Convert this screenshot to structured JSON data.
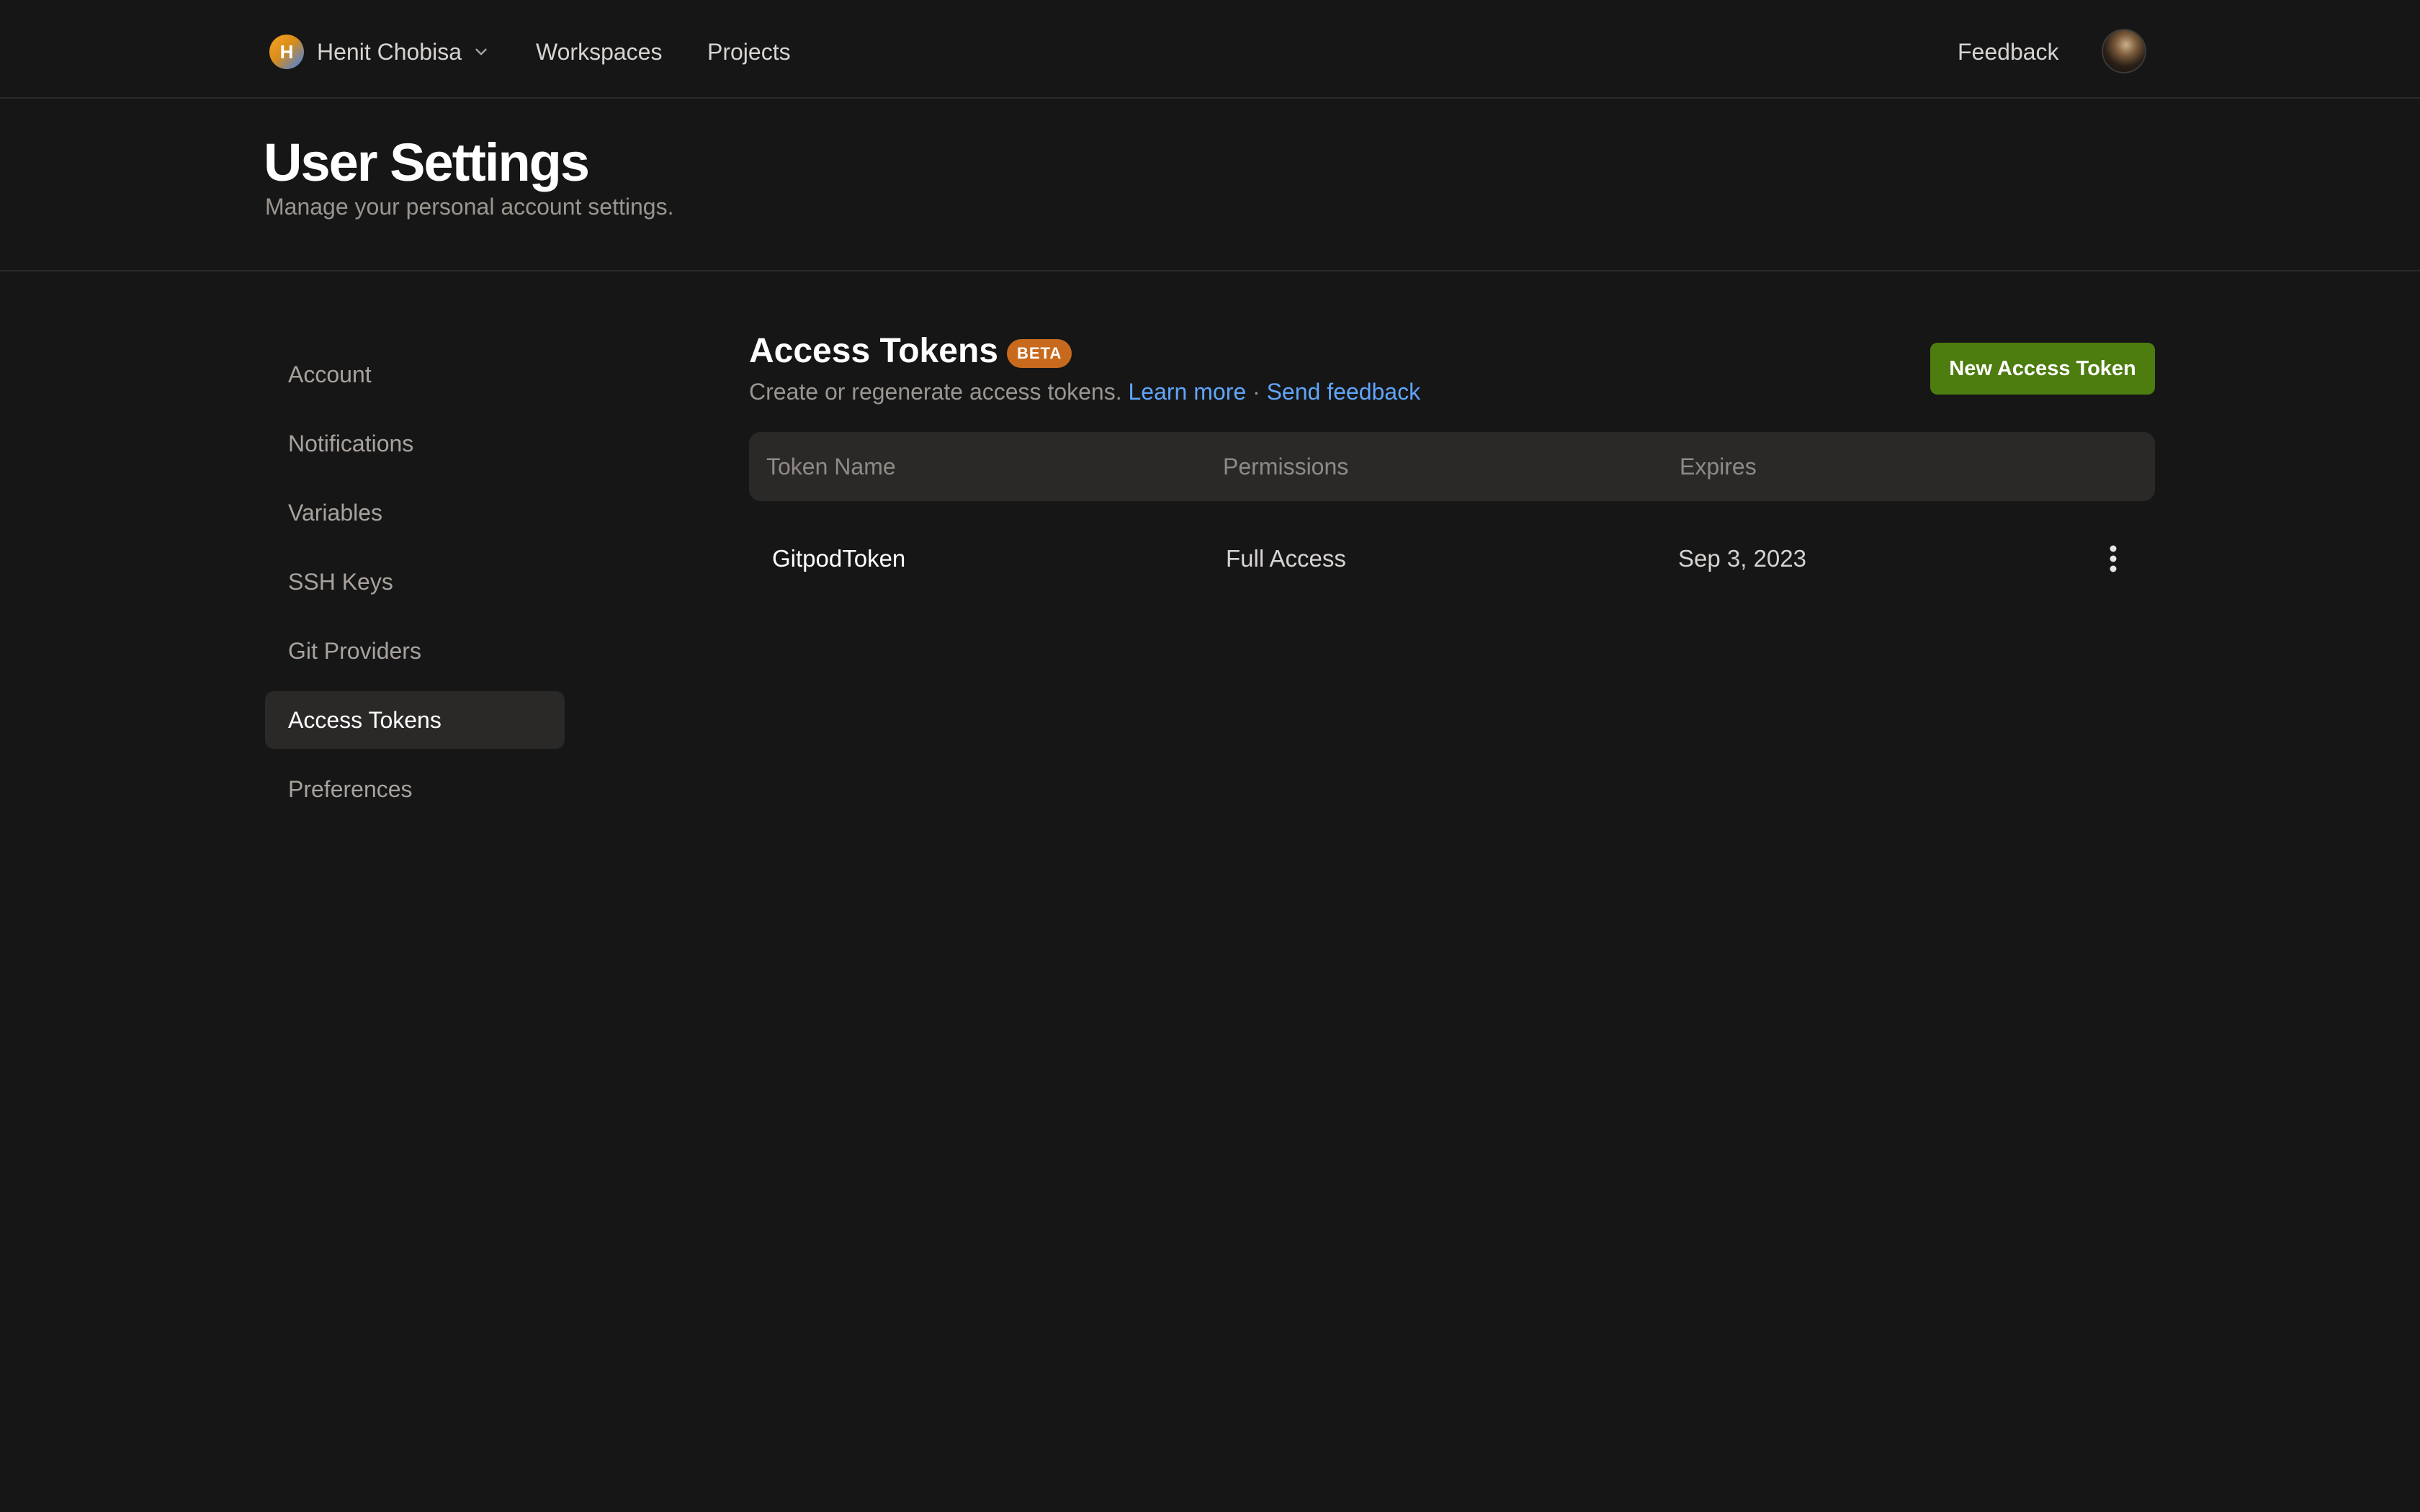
{
  "nav": {
    "org_initial": "H",
    "org_name": "Henit Chobisa",
    "links": [
      "Workspaces",
      "Projects"
    ],
    "feedback": "Feedback"
  },
  "header": {
    "title": "User Settings",
    "subtitle": "Manage your personal account settings."
  },
  "sidebar": {
    "items": [
      {
        "label": "Account"
      },
      {
        "label": "Notifications"
      },
      {
        "label": "Variables"
      },
      {
        "label": "SSH Keys"
      },
      {
        "label": "Git Providers"
      },
      {
        "label": "Access Tokens",
        "active": true
      },
      {
        "label": "Preferences"
      }
    ]
  },
  "main": {
    "title": "Access Tokens",
    "badge": "BETA",
    "description": "Create or regenerate access tokens.",
    "learn_more": "Learn more",
    "separator": "·",
    "send_feedback": "Send feedback",
    "new_button": "New Access Token",
    "table": {
      "headers": [
        "Token Name",
        "Permissions",
        "Expires"
      ],
      "rows": [
        {
          "name": "GitpodToken",
          "permissions": "Full Access",
          "expires": "Sep 3, 2023"
        }
      ]
    }
  },
  "colors": {
    "background": "#161616",
    "accent_green": "#4d7c0f",
    "beta_orange": "#c86a1e",
    "link_blue": "#60a5fa"
  },
  "icons": {
    "org_dropdown": "chevron-down-icon",
    "row_menu": "kebab-menu-icon"
  }
}
